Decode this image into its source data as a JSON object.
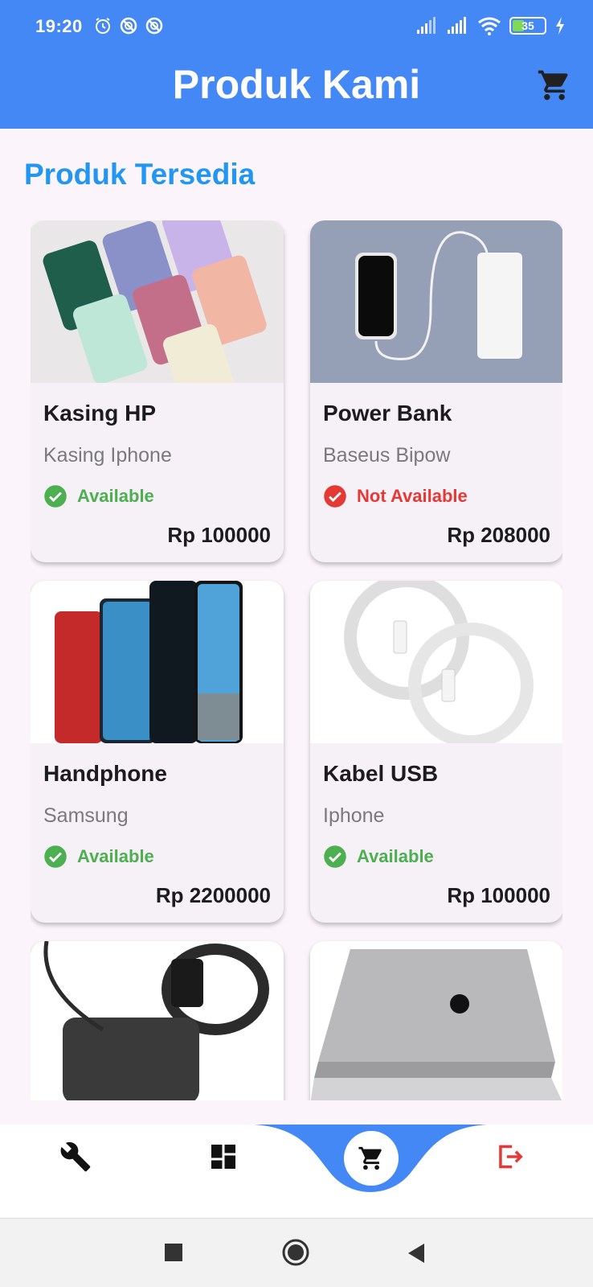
{
  "status_bar": {
    "time": "19:20",
    "battery": "35",
    "icons": [
      "alarm-icon",
      "mute-icon",
      "mute-icon",
      "signal-icon",
      "signal-icon",
      "wifi-icon",
      "battery-icon",
      "charging-icon"
    ]
  },
  "app_bar": {
    "title": "Produk Kami",
    "cart_icon": "cart-icon",
    "color": "#4388f5"
  },
  "section_title": "Produk Tersedia",
  "products": [
    {
      "name": "Kasing HP",
      "subtitle": "Kasing Iphone",
      "status": "Available",
      "available": true,
      "price": "Rp 100000"
    },
    {
      "name": "Power Bank",
      "subtitle": "Baseus Bipow",
      "status": "Not Available",
      "available": false,
      "price": "Rp 208000"
    },
    {
      "name": "Handphone",
      "subtitle": "Samsung",
      "status": "Available",
      "available": true,
      "price": "Rp 2200000"
    },
    {
      "name": "Kabel USB",
      "subtitle": "Iphone",
      "status": "Available",
      "available": true,
      "price": "Rp 100000"
    }
  ],
  "colors": {
    "accent": "#2196f3",
    "available": "#4caf50",
    "not_available": "#e53935",
    "logout": "#e53935"
  },
  "bottom_nav": {
    "items": [
      "wrench-icon",
      "dashboard-icon",
      "cart-icon",
      "logout-icon"
    ],
    "active": "cart-icon"
  },
  "system_nav": [
    "square-icon",
    "circle-icon",
    "back-icon"
  ]
}
